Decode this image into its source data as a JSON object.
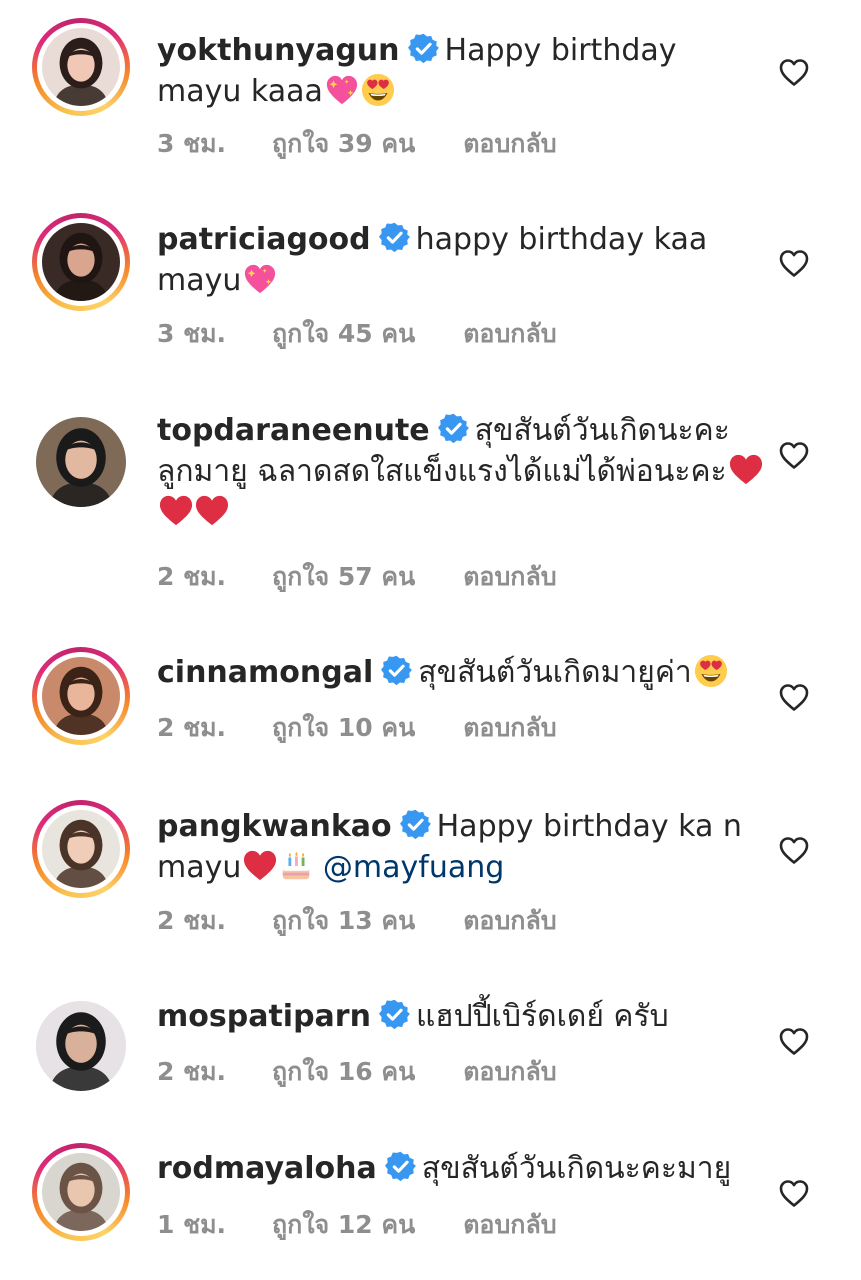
{
  "comments": [
    {
      "username": "yokthunyagun",
      "text": "Happy birthday mayu kaaa",
      "emojis": [
        "sparkling-heart",
        "heart-eyes"
      ],
      "mention": "",
      "time": "3 ชม.",
      "likes": "ถูกใจ 39 คน",
      "reply": "ตอบกลับ",
      "story_ring": true,
      "avatar_palette": [
        "#e9dcd6",
        "#2b1e1a",
        "#f1c7b5"
      ]
    },
    {
      "username": "patriciagood",
      "text": "happy birthday kaa mayu",
      "emojis": [
        "sparkling-heart"
      ],
      "mention": "",
      "time": "3 ชม.",
      "likes": "ถูกใจ 45 คน",
      "reply": "ตอบกลับ",
      "story_ring": true,
      "avatar_palette": [
        "#3a2a26",
        "#1f1512",
        "#d9a58f"
      ]
    },
    {
      "username": "topdaraneenute",
      "text": "สุขสันต์วันเกิดนะคะ ลูกมายู ฉลาดสดใสแข็งแรงได้แม่ได้พ่อนะคะ",
      "emojis": [
        "red-heart",
        "red-heart",
        "red-heart"
      ],
      "mention": "",
      "time": "2 ชม.",
      "likes": "ถูกใจ 57 คน",
      "reply": "ตอบกลับ",
      "story_ring": false,
      "avatar_palette": [
        "#7e6a57",
        "#1a1a1a",
        "#e2b8a0"
      ]
    },
    {
      "username": "cinnamongal",
      "text": "สุขสันต์วันเกิดมายูค่า",
      "emojis": [
        "heart-eyes"
      ],
      "mention": "",
      "time": "2 ชม.",
      "likes": "ถูกใจ 10 คน",
      "reply": "ตอบกลับ",
      "story_ring": true,
      "avatar_palette": [
        "#c98a6c",
        "#3b2318",
        "#e9b69c"
      ]
    },
    {
      "username": "pangkwankao",
      "text": "Happy birthday ka n mayu",
      "emojis": [
        "red-heart",
        "birthday-cake"
      ],
      "mention": "@mayfuang",
      "time": "2 ชม.",
      "likes": "ถูกใจ 13 คน",
      "reply": "ตอบกลับ",
      "story_ring": true,
      "avatar_palette": [
        "#e8e4de",
        "#4a3428",
        "#efcdb8"
      ]
    },
    {
      "username": "mospatiparn",
      "text": "แฮปปี้เบิร์ดเดย์ ครับ",
      "emojis": [],
      "mention": "",
      "time": "2 ชม.",
      "likes": "ถูกใจ 16 คน",
      "reply": "ตอบกลับ",
      "story_ring": false,
      "avatar_palette": [
        "#e6e2e6",
        "#1b1b1b",
        "#d9b099"
      ]
    },
    {
      "username": "rodmayaloha",
      "text": "สุขสันต์วันเกิดนะคะมายู",
      "emojis": [],
      "mention": "",
      "time": "1 ชม.",
      "likes": "ถูกใจ 12 คน",
      "reply": "ตอบกลับ",
      "story_ring": true,
      "avatar_palette": [
        "#d8d6cf",
        "#6b5446",
        "#e8c7ae"
      ]
    }
  ],
  "colors": {
    "text": "#262626",
    "meta": "#8e8e8e",
    "verified": "#3897f0",
    "mention": "#00376b",
    "heart_outline": "#262626"
  },
  "icons": {
    "verified": "verified-badge-icon",
    "like": "heart-outline-icon"
  }
}
